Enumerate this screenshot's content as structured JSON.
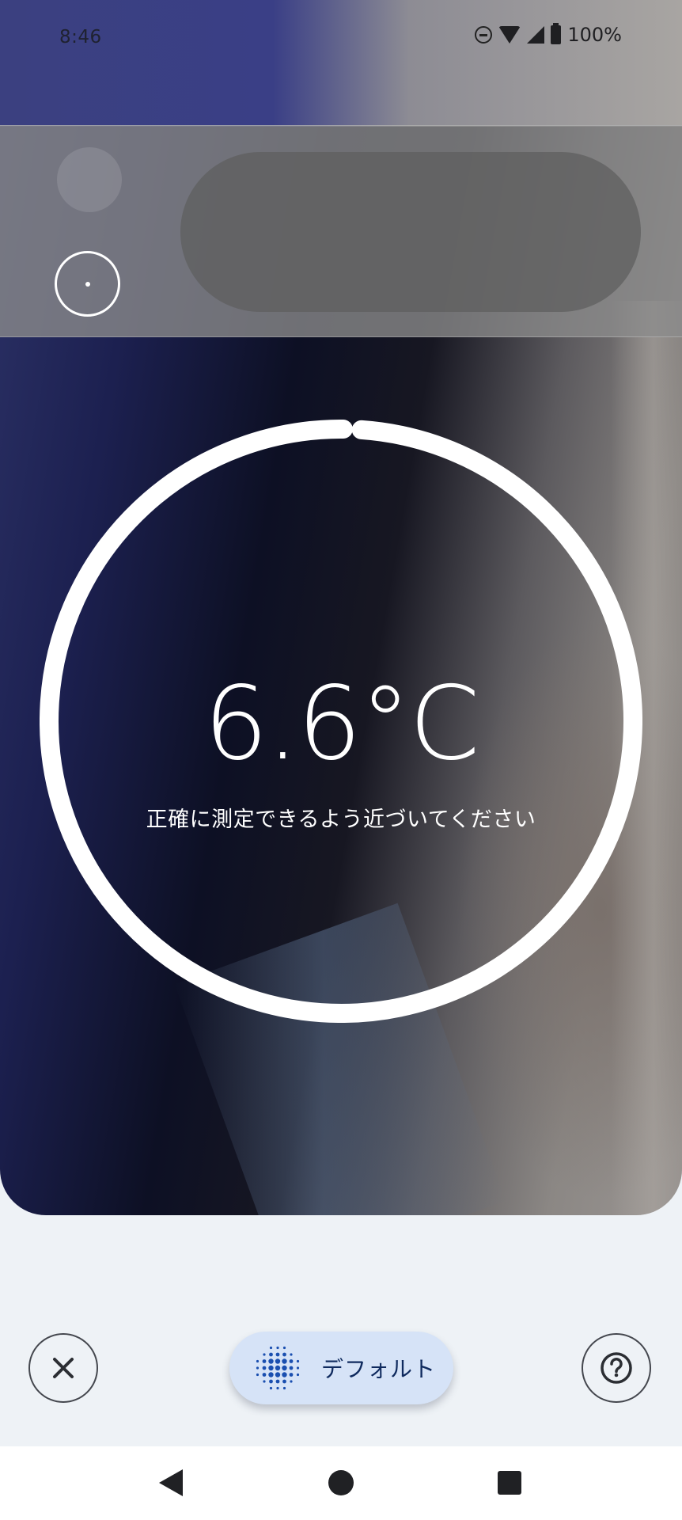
{
  "status_bar": {
    "time": "8:46",
    "battery": "100%"
  },
  "measurement": {
    "temperature": "6.6°C",
    "hint": "正確に測定できるよう近づいてください",
    "ring_progress": 0.99
  },
  "controls": {
    "mode_label": "デフォルト"
  },
  "colors": {
    "mode_button_bg": "#d6e3f7",
    "mode_icon": "#1a4fb0",
    "ring": "#ffffff",
    "background": "#eef2f6"
  },
  "icons": {
    "close": "close-icon",
    "help": "help-icon",
    "mode": "dot-grid-icon",
    "target": "target-icon",
    "dnd": "do-not-disturb-icon",
    "wifi": "wifi-icon",
    "signal": "cell-signal-icon",
    "battery": "battery-icon",
    "back": "back-icon",
    "home": "home-icon",
    "recents": "recents-icon"
  }
}
